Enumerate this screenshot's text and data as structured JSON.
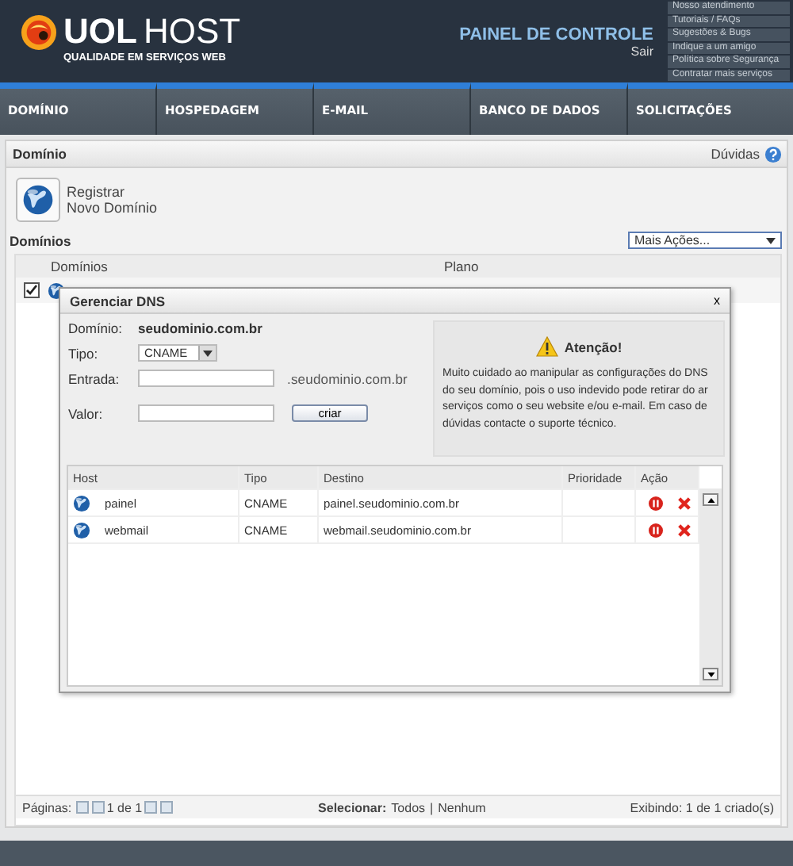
{
  "header": {
    "logo_brand": "UOL",
    "logo_product": "HOST",
    "tagline": "QUALIDADE EM SERVIÇOS WEB",
    "panel_title": "PAINEL DE CONTROLE",
    "logout_link": "Sair",
    "quick_links": [
      "Nosso atendimento",
      "Tutoriais / FAQs",
      "Sugestões & Bugs",
      "Indique a um amigo",
      "Política sobre Segurança",
      "Contratar mais serviços"
    ]
  },
  "nav": {
    "tabs": [
      "DOMÍNIO",
      "HOSPEDAGEM",
      "E-MAIL",
      "BANCO DE DADOS",
      "SOLICITAÇÕES"
    ]
  },
  "page": {
    "title": "Domínio",
    "help_link": "Dúvidas",
    "register_button": {
      "line_1": "Registrar",
      "line_2": "Novo Domínio"
    },
    "section_title": "Domínios",
    "actions_dropdown": "Mais Ações...",
    "table": {
      "columns": [
        "Domínios",
        "Plano"
      ],
      "rows": [
        {
          "checked": true
        }
      ]
    },
    "pager": {
      "label": "Páginas:",
      "page_status": "1 de 1",
      "select_label": "Selecionar:",
      "select_all": "Todos",
      "separator": "|",
      "select_none": "Nenhum",
      "summary": "Exibindo: 1 de 1 criado(s)"
    }
  },
  "dialog": {
    "title": "Gerenciar DNS",
    "close": "x",
    "form": {
      "domain_label": "Domínio:",
      "domain_value": "seudominio.com.br",
      "type_label": "Tipo:",
      "type_value": "CNAME",
      "entry_label": "Entrada:",
      "entry_suffix": ".seudominio.com.br",
      "value_label": "Valor:",
      "create_button": "criar"
    },
    "warning": {
      "title": "Atenção!",
      "text": "Muito cuidado ao manipular as configurações do DNS do seu domínio, pois o uso indevido pode retirar do ar serviços como o seu website e/ou e-mail. Em caso de dúvidas contacte o suporte técnico."
    },
    "records": {
      "columns": [
        "Host",
        "Tipo",
        "Destino",
        "Prioridade",
        "Ação"
      ],
      "rows": [
        {
          "host": "painel",
          "type": "CNAME",
          "destination": "painel.seudominio.com.br"
        },
        {
          "host": "webmail",
          "type": "CNAME",
          "destination": "webmail.seudominio.com.br"
        }
      ]
    }
  }
}
